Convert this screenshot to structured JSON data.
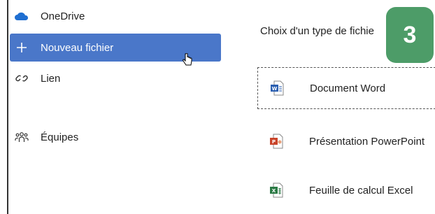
{
  "nav": {
    "onedrive": {
      "label": "OneDrive",
      "icon": "cloud-icon"
    },
    "new_file": {
      "label": "Nouveau fichier",
      "icon": "plus-icon"
    },
    "link": {
      "label": "Lien",
      "icon": "link-icon"
    },
    "teams": {
      "label": "Équipes",
      "icon": "people-icon"
    }
  },
  "panel": {
    "title": "Choix d'un type de fichie",
    "step_badge": "3",
    "files": [
      {
        "label": "Document Word",
        "icon": "word-icon"
      },
      {
        "label": "Présentation PowerPoint",
        "icon": "powerpoint-icon"
      },
      {
        "label": "Feuille de calcul Excel",
        "icon": "excel-icon"
      }
    ]
  },
  "colors": {
    "selected": "#4a77c9",
    "badge": "#4d9c68",
    "word": "#2b5fb0",
    "powerpoint": "#c9442a",
    "excel": "#2b7a45",
    "cloud": "#1f6fd1"
  }
}
